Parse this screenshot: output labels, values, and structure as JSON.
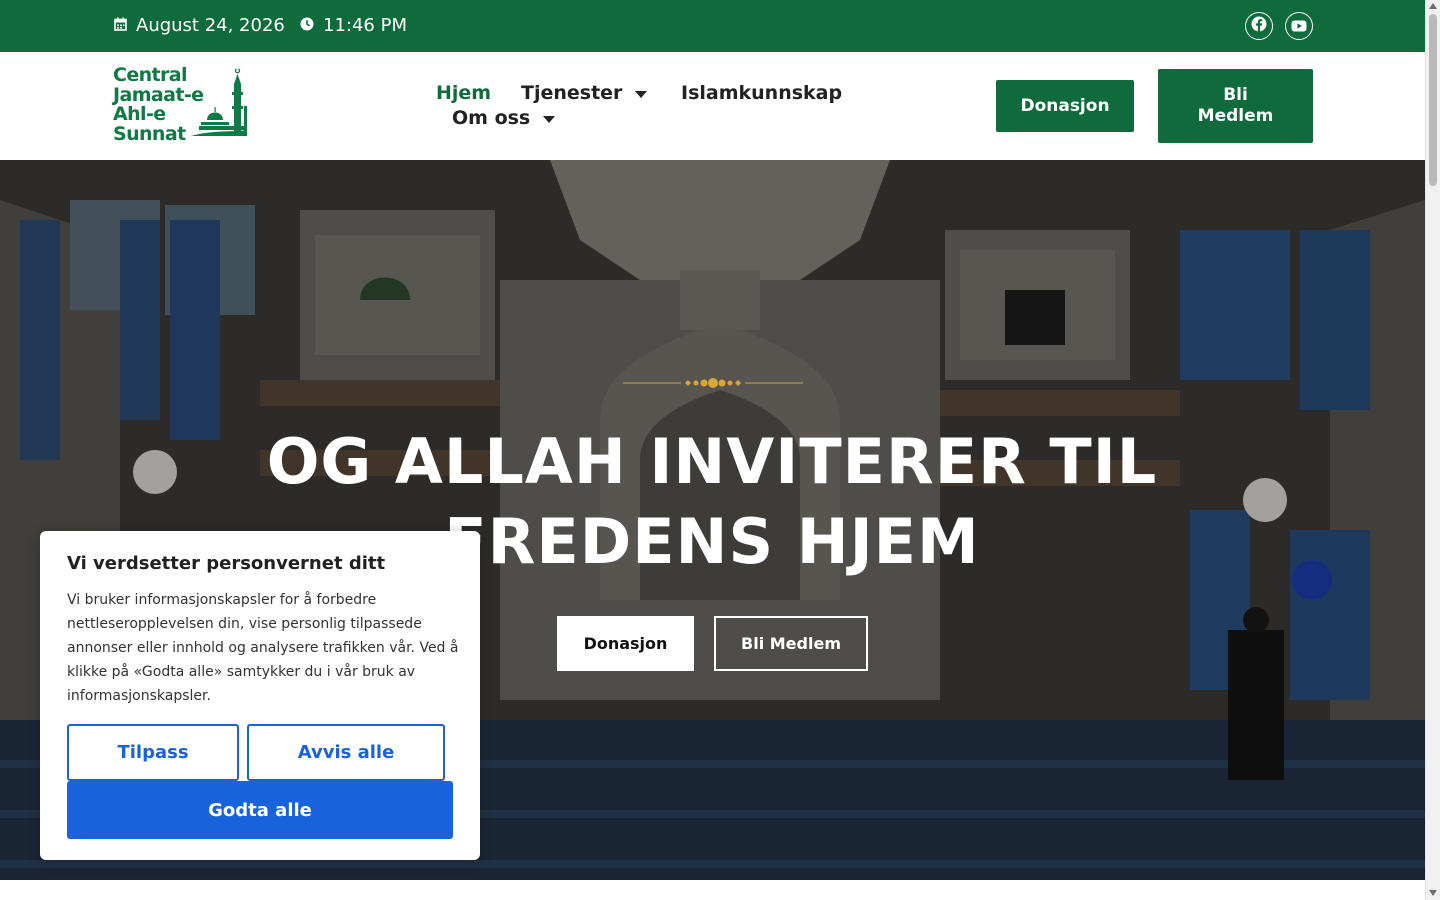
{
  "topbar": {
    "date": "August 24, 2026",
    "time": "11:46 PM",
    "date_icon": "calendar-icon",
    "time_icon": "clock-icon",
    "social": [
      {
        "name": "facebook",
        "icon": "facebook-icon"
      },
      {
        "name": "youtube",
        "icon": "youtube-icon"
      }
    ],
    "bg_color": "#0f6b3c"
  },
  "logo": {
    "line1": "Central",
    "line2": "Jamaat-e",
    "line3": "Ahl-e",
    "line4": "Sunnat",
    "color": "#0f7a45"
  },
  "nav": {
    "items": [
      {
        "label": "Hjem",
        "active": true
      },
      {
        "label": "Tjenester",
        "dropdown": true
      },
      {
        "label": "Islamkunnskap"
      },
      {
        "label": "Om oss",
        "dropdown": true
      }
    ]
  },
  "header_buttons": {
    "donate": "Donasjon",
    "member_line1": "Bli",
    "member_line2": "Medlem"
  },
  "hero": {
    "title_line1": "OG ALLAH INVITERER TIL",
    "title_line2": "FREDENS HJEM",
    "btn_donate": "Donasjon",
    "btn_member": "Bli Medlem"
  },
  "cookie": {
    "title": "Vi verdsetter personvernet ditt",
    "text": "Vi bruker informasjonskapsler for å forbedre nettleseropplevelsen din, vise personlig tilpassede annonser eller innhold og analysere trafikken vår. Ved å klikke på «Godta alle» samtykker du i vår bruk av informasjonskapsler.",
    "btn_customize": "Tilpass",
    "btn_reject": "Avvis alle",
    "btn_accept": "Godta alle",
    "accent": "#1863dc"
  }
}
